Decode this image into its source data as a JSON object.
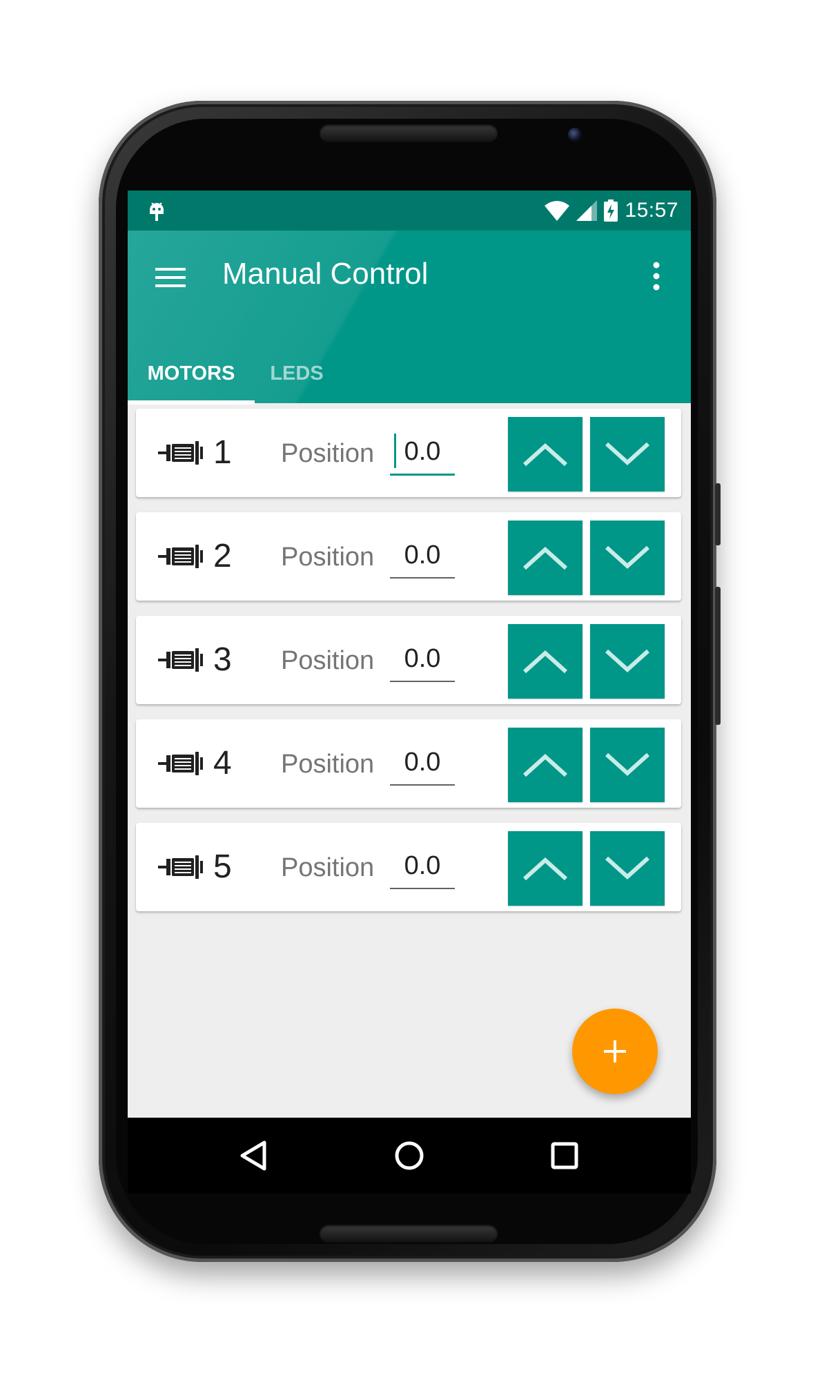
{
  "statusbar": {
    "time": "15:57",
    "icons": [
      "android-debug-icon",
      "wifi-icon",
      "cell-signal-icon",
      "battery-charging-icon"
    ]
  },
  "appbar": {
    "title": "Manual Control",
    "menu_icon": "hamburger-menu-icon",
    "overflow_icon": "more-vert-icon"
  },
  "tabs": [
    {
      "label": "MOTORS",
      "selected": true
    },
    {
      "label": "LEDS",
      "selected": false
    }
  ],
  "motors": [
    {
      "number": "1",
      "position_label": "Position",
      "position_value": "0.0",
      "focused": true
    },
    {
      "number": "2",
      "position_label": "Position",
      "position_value": "0.0",
      "focused": false
    },
    {
      "number": "3",
      "position_label": "Position",
      "position_value": "0.0",
      "focused": false
    },
    {
      "number": "4",
      "position_label": "Position",
      "position_value": "0.0",
      "focused": false
    },
    {
      "number": "5",
      "position_label": "Position",
      "position_value": "0.0",
      "focused": false
    }
  ],
  "motor_row_icons": {
    "motor": "motor-icon",
    "up": "chevron-up-icon",
    "down": "chevron-down-icon"
  },
  "fab": {
    "icon": "plus-icon"
  },
  "navbar": {
    "icons": [
      "back-icon",
      "home-icon",
      "recents-icon"
    ]
  },
  "colors": {
    "primary": "#009688",
    "primary_dark": "#00796b",
    "accent": "#ff9800",
    "background": "#eeeeee"
  }
}
